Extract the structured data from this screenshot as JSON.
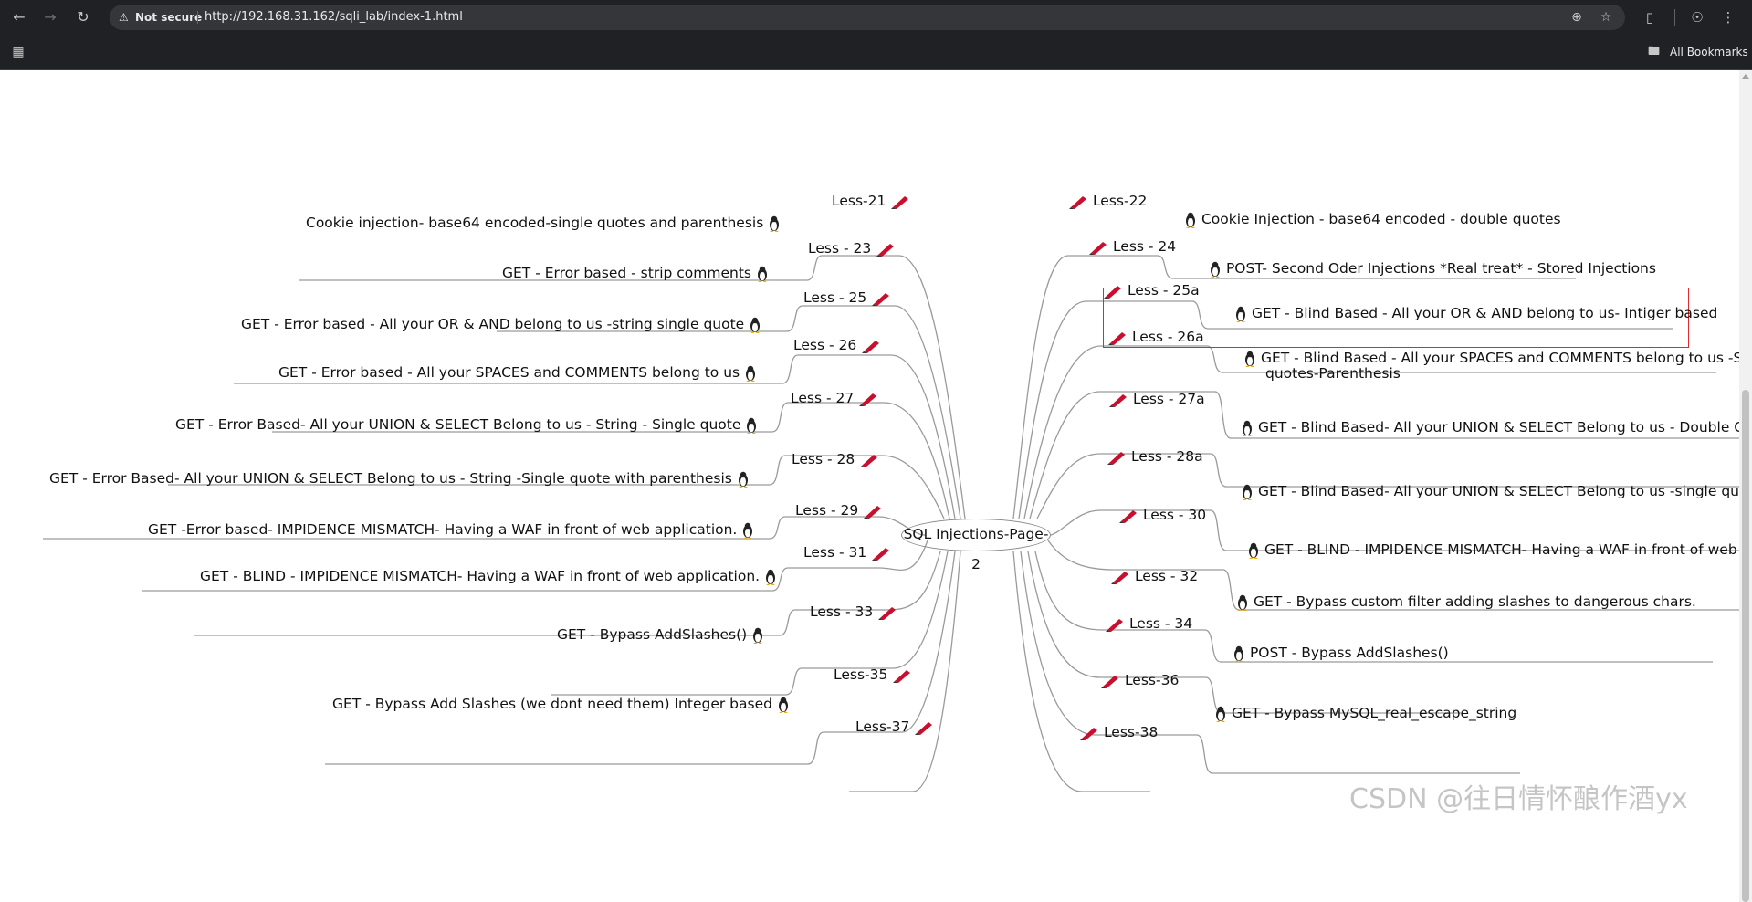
{
  "browser": {
    "security_label": "Not secure",
    "url": "http://192.168.31.162/sqli_lab/index-1.html",
    "bookmarks_label": "All Bookmarks",
    "icons": [
      "back-icon",
      "forward-icon",
      "reload-icon",
      "warning-icon",
      "zoom-icon",
      "star-icon",
      "extensions-icon",
      "profile-icon",
      "menu-icon",
      "apps-icon",
      "folder-icon"
    ]
  },
  "mindmap": {
    "root": "SQL Injections-Page-2",
    "left": [
      {
        "lesson": "Less-21",
        "desc": "Cookie injection- base64 encoded-single quotes and parenthesis"
      },
      {
        "lesson": "Less - 23",
        "desc": "GET - Error based - strip comments"
      },
      {
        "lesson": "Less - 25",
        "desc": "GET - Error based - All your OR & AND belong to us -string single quote"
      },
      {
        "lesson": "Less - 26",
        "desc": "GET - Error based - All your SPACES and COMMENTS belong to us"
      },
      {
        "lesson": "Less - 27",
        "desc": "GET - Error Based- All your UNION & SELECT Belong to us - String - Single quote"
      },
      {
        "lesson": "Less - 28",
        "desc": "GET - Error Based- All your UNION & SELECT Belong to us - String -Single quote with parenthesis"
      },
      {
        "lesson": "Less - 29",
        "desc": "GET -Error based- IMPIDENCE MISMATCH- Having a WAF in front of web application."
      },
      {
        "lesson": "Less - 31",
        "desc": "GET - BLIND - IMPIDENCE MISMATCH- Having a WAF in front of web application."
      },
      {
        "lesson": "Less - 33",
        "desc": "GET - Bypass AddSlashes()"
      },
      {
        "lesson": "Less-35",
        "desc": "GET - Bypass Add Slashes (we dont need them) Integer based"
      },
      {
        "lesson": "Less-37",
        "desc": ""
      }
    ],
    "right": [
      {
        "lesson": "Less-22",
        "desc": "Cookie Injection - base64 encoded - double quotes",
        "desc2": ""
      },
      {
        "lesson": "Less - 24",
        "desc": "POST- Second Oder Injections *Real treat* - Stored Injections",
        "desc2": ""
      },
      {
        "lesson": "Less - 25a",
        "desc": "GET - Blind Based - All your OR & AND belong to us- Intiger based",
        "desc2": ""
      },
      {
        "lesson": "Less - 26a",
        "desc": "GET - Blind Based - All your SPACES and COMMENTS belong to us -S",
        "desc2": "quotes-Parenthesis"
      },
      {
        "lesson": "Less - 27a",
        "desc": "GET - Blind Based- All your UNION & SELECT Belong to us - Double Q",
        "desc2": ""
      },
      {
        "lesson": "Less - 28a",
        "desc": "GET - Blind Based- All your UNION & SELECT Belong to us -single qu",
        "desc2": ""
      },
      {
        "lesson": "Less - 30",
        "desc": "GET - BLIND - IMPIDENCE MISMATCH- Having a WAF in front of web a",
        "desc2": ""
      },
      {
        "lesson": "Less - 32",
        "desc": "GET - Bypass custom filter adding slashes to dangerous chars.",
        "desc2": ""
      },
      {
        "lesson": "Less - 34",
        "desc": "POST - Bypass AddSlashes()",
        "desc2": ""
      },
      {
        "lesson": "Less-36",
        "desc": "GET - Bypass MySQL_real_escape_string",
        "desc2": ""
      },
      {
        "lesson": "Less-38",
        "desc": "",
        "desc2": ""
      }
    ]
  },
  "watermark": "CSDN @往日情怀酿作酒yx",
  "colors": {
    "chrome": "#202124",
    "address_bar": "#35363a",
    "highlight": "#e0282e",
    "pencil_red": "#c8102e"
  }
}
